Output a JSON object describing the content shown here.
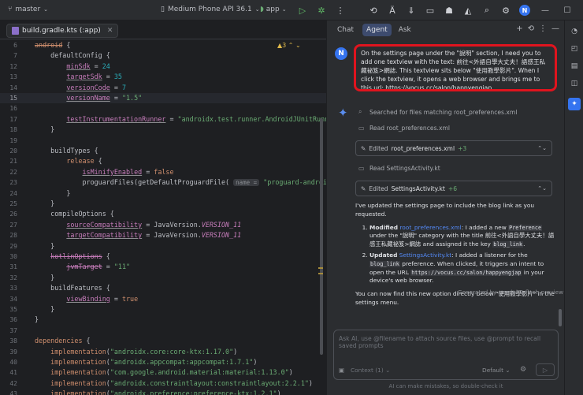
{
  "titlebar": {
    "branch": "master",
    "device": "Medium Phone API 36.1",
    "run_config": "app",
    "avatar_letter": "N"
  },
  "editor": {
    "tab_label": "build.gradle.kts (:app)",
    "warning_count": "3",
    "lines": [
      {
        "n": "6",
        "html": "<span class=\"kw strike\">android</span> {"
      },
      {
        "n": "7",
        "html": "    defaultConfig {"
      },
      {
        "n": "12",
        "html": "        <span class=\"prop und\">minSdk</span> = <span class=\"num\">24</span>"
      },
      {
        "n": "13",
        "html": "        <span class=\"prop und\">targetSdk</span> = <span class=\"num\">35</span>"
      },
      {
        "n": "14",
        "html": "        <span class=\"prop und\">versionCode</span> = <span class=\"num\">7</span>"
      },
      {
        "n": "15",
        "html": "        <span class=\"prop und\">versionName</span> = <span class=\"str\">\"1.5\"</span>"
      },
      {
        "n": "16",
        "html": ""
      },
      {
        "n": "17",
        "html": "        <span class=\"prop und\">testInstrumentationRunner</span> = <span class=\"str\">\"androidx.test.runner.AndroidJUnitRunner\"</span>"
      },
      {
        "n": "18",
        "html": "    }"
      },
      {
        "n": "19",
        "html": ""
      },
      {
        "n": "20",
        "html": "    buildTypes {"
      },
      {
        "n": "21",
        "html": "        <span class=\"kw\">release</span> {"
      },
      {
        "n": "22",
        "html": "            <span class=\"prop und\">isMinifyEnabled</span> = <span class=\"kw\">false</span>"
      },
      {
        "n": "23",
        "html": "            proguardFiles(getDefaultProguardFile( <span class=\"hint\">name =</span> <span class=\"str\">\"proguard-android-op</span>"
      },
      {
        "n": "24",
        "html": "        }"
      },
      {
        "n": "25",
        "html": "    }"
      },
      {
        "n": "26",
        "html": "    compileOptions {"
      },
      {
        "n": "27",
        "html": "        <span class=\"prop und\">sourceCompatibility</span> = JavaVersion.<span class=\"const\">VERSION_11</span>"
      },
      {
        "n": "28",
        "html": "        <span class=\"prop und\">targetCompatibility</span> = JavaVersion.<span class=\"const\">VERSION_11</span>"
      },
      {
        "n": "29",
        "html": "    }"
      },
      {
        "n": "30",
        "html": "    <span class=\"prop strike\">kotlinOptions</span> {"
      },
      {
        "n": "31",
        "html": "        <span class=\"prop strike\">jvmTarget</span> = <span class=\"str\">\"11\"</span>"
      },
      {
        "n": "32",
        "html": "    }"
      },
      {
        "n": "33",
        "html": "    buildFeatures {"
      },
      {
        "n": "34",
        "html": "        <span class=\"prop und\">viewBinding</span> = <span class=\"kw\">true</span>"
      },
      {
        "n": "35",
        "html": "    }"
      },
      {
        "n": "36",
        "html": "}"
      },
      {
        "n": "37",
        "html": ""
      },
      {
        "n": "38",
        "html": "<span class=\"kw\">dependencies</span> {"
      },
      {
        "n": "39",
        "html": "    <span class=\"kw\">implementation</span>(<span class=\"str\">\"androidx.core:core-ktx:1.17.0\"</span>)"
      },
      {
        "n": "40",
        "html": "    <span class=\"kw\">implementation</span>(<span class=\"str\">\"androidx.appcompat:appcompat:1.7.1\"</span>)"
      },
      {
        "n": "41",
        "html": "    <span class=\"kw\">implementation</span>(<span class=\"str\">\"com.google.android.material:material:1.13.0\"</span>)"
      },
      {
        "n": "42",
        "html": "    <span class=\"kw\">implementation</span>(<span class=\"str\">\"androidx.constraintlayout:constraintlayout:2.2.1\"</span>)"
      },
      {
        "n": "43",
        "html": "    <span class=\"kw\">implementation</span>(<span class=\"str\">\"androidx.preference:preference-ktx:1.2.1\"</span>)"
      }
    ],
    "current_line": "15"
  },
  "chat": {
    "tabs": [
      "Chat",
      "Agent",
      "Ask"
    ],
    "active_tab": "Agent",
    "user_avatar": "N",
    "user_message": "On the settings page under the \"說明\" section, I need you to add one textview with the text: 前往<外語自學大丈夫！語感王私藏祕笈>網誌. This textview sits below \"使用教學影片\".  When I click the textview, it opens a web browser and brings me to this url:  https://vocus.cc/salon/happyengjap",
    "steps": {
      "search": "Searched for files matching root_preferences.xml",
      "read1": "Read root_preferences.xml",
      "edit1_label": "Edited",
      "edit1_file": "root_preferences.xml",
      "edit1_count": "+3",
      "read2": "Read SettingsActivity.kt",
      "edit2_label": "Edited",
      "edit2_file": "SettingsActivity.kt",
      "edit2_count": "+6"
    },
    "answer": {
      "intro": "I've updated the settings page to include the blog link as you requested.",
      "item1_label": "Modified",
      "item1_file": "root_preferences.xml",
      "item1_a": ": I added a new ",
      "item1_code1": "Preference",
      "item1_b": " under the \"說明\" category with the title 前往<外語自學大丈夫！語感王私藏祕笈>網誌 and assigned it the key ",
      "item1_code2": "blog_link",
      "item1_c": ".",
      "item2_label": "Updated",
      "item2_file": "SettingsActivity.kt",
      "item2_a": ": I added a listener for the ",
      "item2_code1": "blog_link",
      "item2_b": " preference. When clicked, it triggers an intent to open the URL ",
      "item2_code2": "https://vocus.cc/salon/happyengjap",
      "item2_c": " in your device's web browser.",
      "outro": "You can now find this new option directly below \"使用教學影片\" in the settings menu."
    },
    "generated_by": "Generated by gemini-3-flash-preview",
    "input_placeholder": "Ask AI, use @filename to attach source files, use @prompt to recall saved prompts",
    "context_label": "Context (1)",
    "model_select": "Default",
    "disclaimer": "AI can make mistakes, so double-check it"
  }
}
